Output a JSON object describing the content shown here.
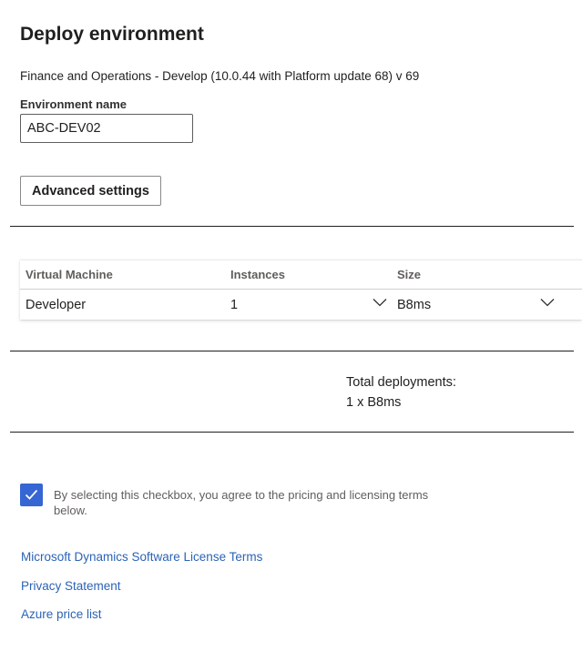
{
  "header": {
    "title": "Deploy environment",
    "subtitle": "Finance and Operations - Develop (10.0.44 with Platform update 68) v 69"
  },
  "environment_name": {
    "label": "Environment name",
    "value": "ABC-DEV02"
  },
  "advanced_settings_label": "Advanced settings",
  "vm_table": {
    "columns": [
      "Virtual Machine",
      "Instances",
      "Size"
    ],
    "row": {
      "virtual_machine": "Developer",
      "instances": "1",
      "size": "B8ms"
    }
  },
  "summary": {
    "total_label": "Total deployments:",
    "total_value": "1 x B8ms"
  },
  "agreement": {
    "checked": true,
    "text": "By selecting this checkbox, you agree to the pricing and licensing terms below."
  },
  "links": [
    "Microsoft Dynamics Software License Terms",
    "Privacy Statement",
    "Azure price list"
  ],
  "colors": {
    "accent": "#3666d4",
    "link": "#2b63b5"
  },
  "icons": {
    "dropdown": "chevron-down-icon",
    "checkbox": "checkmark-icon"
  }
}
